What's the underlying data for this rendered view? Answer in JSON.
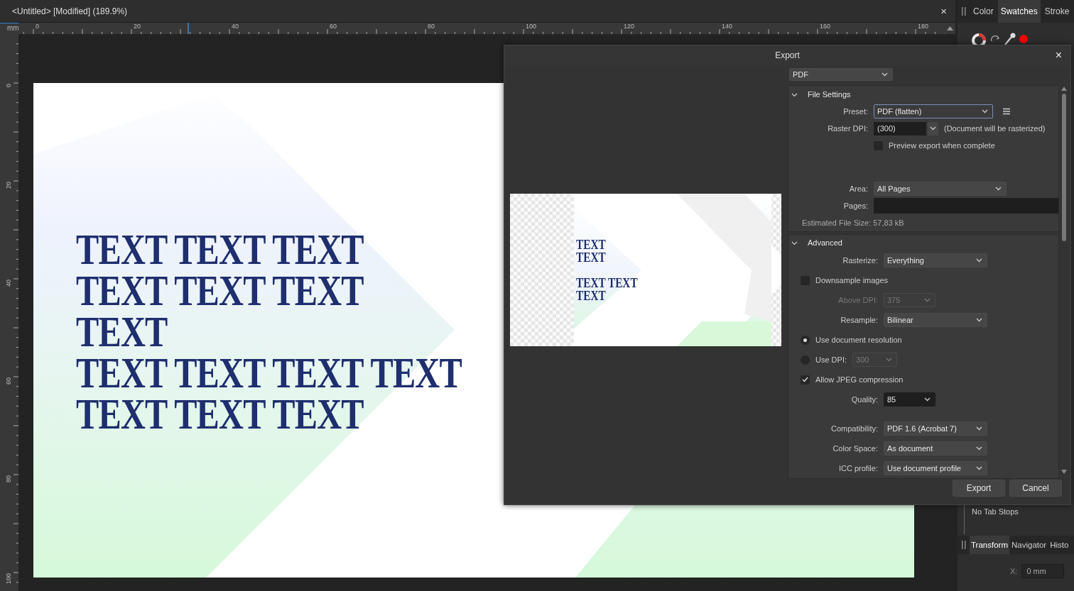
{
  "document": {
    "title": "<Untitled> [Modified] (189.9%)",
    "close": "×"
  },
  "ruler": {
    "unit": "mm",
    "h_labels": [
      "0",
      "20",
      "40",
      "60",
      "80",
      "100",
      "120",
      "140",
      "160",
      "180"
    ],
    "v_labels": [
      "0",
      "20",
      "40",
      "60",
      "80",
      "100"
    ]
  },
  "page": {
    "lines": [
      "TEXT TEXT TEXT",
      "TEXT TEXT TEXT",
      "TEXT",
      "TEXT TEXT TEXT TEXT",
      "TEXT TEXT TEXT"
    ]
  },
  "panel": {
    "tabs": [
      {
        "label": "Color",
        "selected": false
      },
      {
        "label": "Swatches",
        "selected": true
      },
      {
        "label": "Stroke",
        "selected": false
      }
    ],
    "tab_stops": "No Tab Stops",
    "bottom_tabs": [
      {
        "label": "Transform",
        "selected": true
      },
      {
        "label": "Navigator",
        "selected": false
      },
      {
        "label": "Histo",
        "selected": false
      }
    ],
    "x_label": "X:",
    "x_value": "0 mm"
  },
  "dialog": {
    "title": "Export",
    "close": "×",
    "format": "PDF",
    "preview_lines": [
      "TEXT",
      "TEXT",
      "TEXT TEXT",
      "TEXT"
    ],
    "sections": [
      {
        "title": "File Settings",
        "expanded": true,
        "groups": [
          [
            {
              "kind": "preset",
              "label": "Preset:",
              "value": "PDF (flatten)"
            },
            {
              "kind": "combo",
              "label": "Raster DPI:",
              "value": "(300)",
              "note": "(Document will be rasterized)"
            },
            {
              "kind": "option",
              "label": "Preview export when complete",
              "checked": false
            }
          ],
          [
            {
              "kind": "select",
              "label": "Area:",
              "value": "All Pages",
              "disabled": false
            },
            {
              "kind": "field",
              "label": "Pages:"
            },
            {
              "kind": "info",
              "text": "Estimated File Size: 57,83 kB"
            }
          ]
        ]
      },
      {
        "title": "Advanced",
        "expanded": true,
        "groups": [
          [
            {
              "kind": "select",
              "label": "Rasterize:",
              "value": "Everything",
              "disabled": false
            },
            {
              "kind": "checkbox",
              "label": "Downsample images",
              "checked": false
            },
            {
              "kind": "small_select",
              "label": "Above DPI:",
              "value": "375",
              "disabled": true
            },
            {
              "kind": "select",
              "label": "Resample:",
              "value": "Bilinear",
              "disabled": false
            },
            {
              "kind": "radio",
              "label": "Use document resolution",
              "selected": true
            },
            {
              "kind": "radio",
              "label": "Use DPI:",
              "selected": false,
              "value": "300"
            },
            {
              "kind": "checkbox",
              "label": "Allow JPEG compression",
              "checked": true
            },
            {
              "kind": "dark_select",
              "label": "Quality:",
              "value": "85"
            }
          ],
          [
            {
              "kind": "select",
              "label": "Compatibility:",
              "value": "PDF 1.6 (Acrobat 7)",
              "disabled": false
            },
            {
              "kind": "select",
              "label": "Color Space:",
              "value": "As document",
              "disabled": false
            },
            {
              "kind": "select",
              "label": "ICC profile:",
              "value": "Use document profile",
              "disabled": false
            }
          ]
        ]
      }
    ],
    "buttons": [
      "Export",
      "Cancel"
    ]
  }
}
